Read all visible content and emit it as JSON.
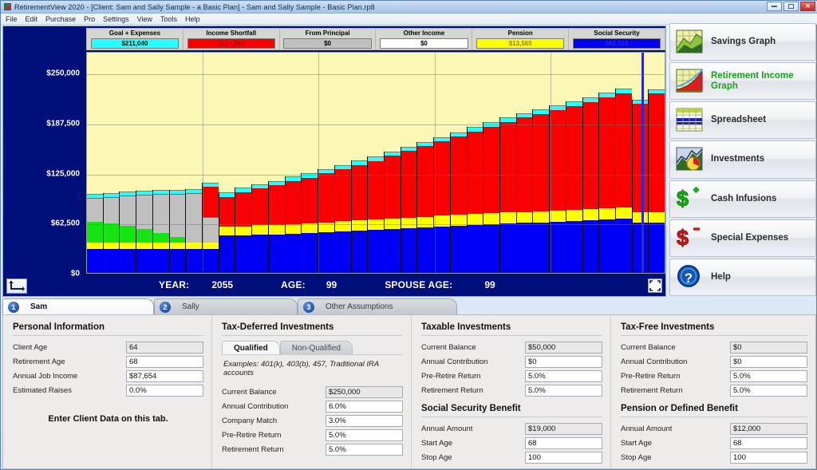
{
  "window": {
    "title": "RetirementView 2020 - [Client: Sam and Sally Sample - a Basic Plan] - Sam and Sally Sample - Basic Plan.rp8",
    "controls": {
      "minimize": "–",
      "maximize": "□",
      "close": "✕"
    }
  },
  "menu": [
    "File",
    "Edit",
    "Purchase",
    "Pro",
    "Settings",
    "View",
    "Tools",
    "Help"
  ],
  "legend": [
    {
      "title": "Goal + Expenses",
      "value": "$211,040",
      "color": "#25ffff",
      "text_color": "#000000"
    },
    {
      "title": "Income Shortfall",
      "value": "$134,959",
      "color": "#fb0000",
      "text_color": "#b00000"
    },
    {
      "title": "From Principal",
      "value": "$0",
      "color": "#c0c0c0",
      "text_color": "#000000"
    },
    {
      "title": "Other Income",
      "value": "$0",
      "color": "#ffffff",
      "text_color": "#000000"
    },
    {
      "title": "Pension",
      "value": "$13,565",
      "color": "#ffff00",
      "text_color": "#9a7a00"
    },
    {
      "title": "Social Security",
      "value": "$62,516",
      "color": "#0000f4",
      "text_color": "#2a2adf"
    }
  ],
  "status": {
    "year_label": "YEAR:",
    "year_value": "2055",
    "age_label": "AGE:",
    "age_value": "99",
    "spouse_label": "SPOUSE AGE:",
    "spouse_value": "99",
    "axis_icon": "axes-arrow-icon",
    "expand_icon": "expand-fullscreen-icon"
  },
  "sidebar": {
    "items": [
      {
        "label": "Savings Graph",
        "icon": "area-chart-icon",
        "active": false
      },
      {
        "label": "Retirement Income Graph",
        "icon": "income-graph-icon",
        "active": true
      },
      {
        "label": "Spreadsheet",
        "icon": "spreadsheet-grid-icon",
        "active": false
      },
      {
        "label": "Investments",
        "icon": "investments-pie-icon",
        "active": false
      },
      {
        "label": "Cash Infusions",
        "icon": "dollar-plus-icon",
        "active": false
      },
      {
        "label": "Special Expenses",
        "icon": "dollar-minus-icon",
        "active": false
      },
      {
        "label": "Help",
        "icon": "question-mark-icon",
        "active": false
      }
    ],
    "accent_active": "#19a319"
  },
  "tabs": [
    {
      "num": "1",
      "label": "Sam",
      "active": true
    },
    {
      "num": "2",
      "label": "Sally",
      "active": false
    },
    {
      "num": "3",
      "label": "Other Assumptions",
      "active": false
    }
  ],
  "forms": {
    "personal": {
      "title": "Personal Information",
      "rows": [
        {
          "label": "Client Age",
          "value": "64",
          "shaded": true
        },
        {
          "label": "Retirement Age",
          "value": "68",
          "shaded": false
        },
        {
          "label": "Annual Job Income",
          "value": "$87,654",
          "shaded": false
        },
        {
          "label": "Estimated Raises",
          "value": "0.0%",
          "shaded": false
        }
      ],
      "note": "Enter Client Data on this tab."
    },
    "tax_deferred": {
      "title": "Tax-Deferred Investments",
      "subtabs": [
        {
          "label": "Qualified",
          "active": true
        },
        {
          "label": "Non-Qualified",
          "active": false
        }
      ],
      "example": "Examples: 401(k), 403(b), 457, Traditional IRA accounts",
      "rows": [
        {
          "label": "Current Balance",
          "value": "$250,000",
          "shaded": true
        },
        {
          "label": "Annual Contribution",
          "value": "6.0%",
          "shaded": false
        },
        {
          "label": "Company Match",
          "value": "3.0%",
          "shaded": false
        },
        {
          "label": "Pre-Retire Return",
          "value": "5.0%",
          "shaded": false
        },
        {
          "label": "Retirement Return",
          "value": "5.0%",
          "shaded": false
        }
      ]
    },
    "taxable": {
      "title": "Taxable Investments",
      "rows": [
        {
          "label": "Current Balance",
          "value": "$50,000",
          "shaded": true
        },
        {
          "label": "Annual Contribution",
          "value": "$0",
          "shaded": false
        },
        {
          "label": "Pre-Retire Return",
          "value": "5.0%",
          "shaded": false
        },
        {
          "label": "Retirement Return",
          "value": "5.0%",
          "shaded": false
        }
      ]
    },
    "social_security": {
      "title": "Social Security Benefit",
      "rows": [
        {
          "label": "Annual Amount",
          "value": "$19,000",
          "shaded": true
        },
        {
          "label": "Start Age",
          "value": "68",
          "shaded": false
        },
        {
          "label": "Stop Age",
          "value": "100",
          "shaded": false
        }
      ]
    },
    "tax_free": {
      "title": "Tax-Free Investments",
      "rows": [
        {
          "label": "Current Balance",
          "value": "$0",
          "shaded": true
        },
        {
          "label": "Annual Contribution",
          "value": "$0",
          "shaded": false
        },
        {
          "label": "Pre-Retire Return",
          "value": "5.0%",
          "shaded": false
        },
        {
          "label": "Retirement Return",
          "value": "5.0%",
          "shaded": false
        }
      ]
    },
    "pension": {
      "title": "Pension or Defined Benefit",
      "rows": [
        {
          "label": "Annual Amount",
          "value": "$12,000",
          "shaded": true
        },
        {
          "label": "Start Age",
          "value": "68",
          "shaded": false
        },
        {
          "label": "Stop Age",
          "value": "100",
          "shaded": false
        }
      ]
    }
  },
  "chart_data": {
    "type": "bar",
    "title": "Retirement Income Graph",
    "stacked": true,
    "xlabel": "",
    "ylabel": "",
    "ylim": [
      0,
      277000
    ],
    "yticks": [
      0,
      62500,
      125000,
      187500,
      250000
    ],
    "ytick_labels": [
      "$0",
      "$62,500",
      "$125,000",
      "$187,500",
      "$250,000"
    ],
    "grid": true,
    "legend_position": "top",
    "cursor_bar_index": 33,
    "cursor_year": "2055",
    "series": [
      {
        "name": "Social Security",
        "color": "#0000f4",
        "values": [
          30000,
          30000,
          30000,
          30000,
          30000,
          30000,
          30000,
          30000,
          47000,
          47000,
          48000,
          48000,
          49000,
          50000,
          51000,
          52000,
          53000,
          54000,
          55000,
          56000,
          57000,
          58000,
          59000,
          60000,
          61000,
          62000,
          62516,
          63000,
          64000,
          65000,
          66000,
          67000,
          68000,
          62516,
          62516
        ]
      },
      {
        "name": "Pension",
        "color": "#ffff00",
        "values": [
          7500,
          7500,
          7500,
          7500,
          7500,
          7500,
          7500,
          7500,
          11000,
          11000,
          11500,
          11500,
          11800,
          12000,
          12200,
          12400,
          12600,
          12800,
          13000,
          13100,
          13200,
          13300,
          13400,
          13500,
          13565,
          13565,
          13565,
          13565,
          13565,
          13565,
          13565,
          13565,
          13565,
          13565,
          13565
        ]
      },
      {
        "name": "Other Income",
        "color": "#12e512",
        "values": [
          26000,
          24000,
          21000,
          17000,
          12000,
          7000,
          0,
          0,
          0,
          0,
          0,
          0,
          0,
          0,
          0,
          0,
          0,
          0,
          0,
          0,
          0,
          0,
          0,
          0,
          0,
          0,
          0,
          0,
          0,
          0,
          0,
          0,
          0,
          0,
          0
        ]
      },
      {
        "name": "From Principal",
        "color": "#c0c0c0",
        "values": [
          30000,
          33000,
          38000,
          43000,
          49000,
          54000,
          62000,
          32000,
          0,
          0,
          0,
          0,
          0,
          0,
          0,
          0,
          0,
          0,
          0,
          0,
          0,
          0,
          0,
          0,
          0,
          0,
          0,
          0,
          0,
          0,
          0,
          0,
          0,
          0,
          0
        ]
      },
      {
        "name": "Income Shortfall",
        "color": "#fb0000",
        "values": [
          0,
          0,
          0,
          0,
          0,
          0,
          0,
          38000,
          37000,
          43000,
          46000,
          50000,
          54000,
          57000,
          61000,
          65000,
          69000,
          73000,
          78000,
          83000,
          88000,
          93000,
          98000,
          103000,
          108000,
          113000,
          118000,
          122000,
          126000,
          130000,
          134000,
          139000,
          143000,
          134959,
          148000
        ]
      },
      {
        "name": "Goal + Expenses",
        "color": "#25ffff",
        "values": [
          5500,
          5500,
          5500,
          5500,
          5500,
          5500,
          5500,
          5500,
          5500,
          5500,
          5500,
          5500,
          5500,
          5500,
          5500,
          5500,
          5500,
          5500,
          5500,
          5500,
          5500,
          5500,
          5500,
          5500,
          5500,
          5500,
          5500,
          5500,
          5500,
          5500,
          5500,
          5500,
          5500,
          5500,
          5500
        ]
      }
    ]
  }
}
